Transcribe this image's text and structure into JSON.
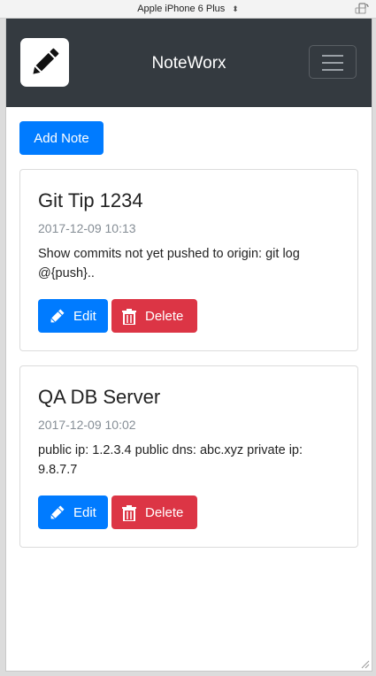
{
  "device_bar": {
    "device_name": "Apple iPhone 6 Plus",
    "arrow": "⬍",
    "rotate_icon": "rotate-device-icon"
  },
  "navbar": {
    "brand": "NoteWorx",
    "logo_icon": "pencil-icon",
    "toggler_icon": "hamburger-menu-icon",
    "background": "#343a40"
  },
  "toolbar": {
    "add_note_label": "Add Note"
  },
  "notes": [
    {
      "title": "Git Tip 1234",
      "date": "2017-12-09 10:13",
      "text": "Show commits not yet pushed to origin: git log @{push}..",
      "edit_label": "Edit",
      "delete_label": "Delete"
    },
    {
      "title": "QA DB Server",
      "date": "2017-12-09 10:02",
      "text": "public ip: 1.2.3.4 public dns: abc.xyz private ip: 9.8.7.7",
      "edit_label": "Edit",
      "delete_label": "Delete"
    }
  ],
  "colors": {
    "primary": "#007bff",
    "danger": "#dc3545",
    "muted": "#868e96"
  }
}
